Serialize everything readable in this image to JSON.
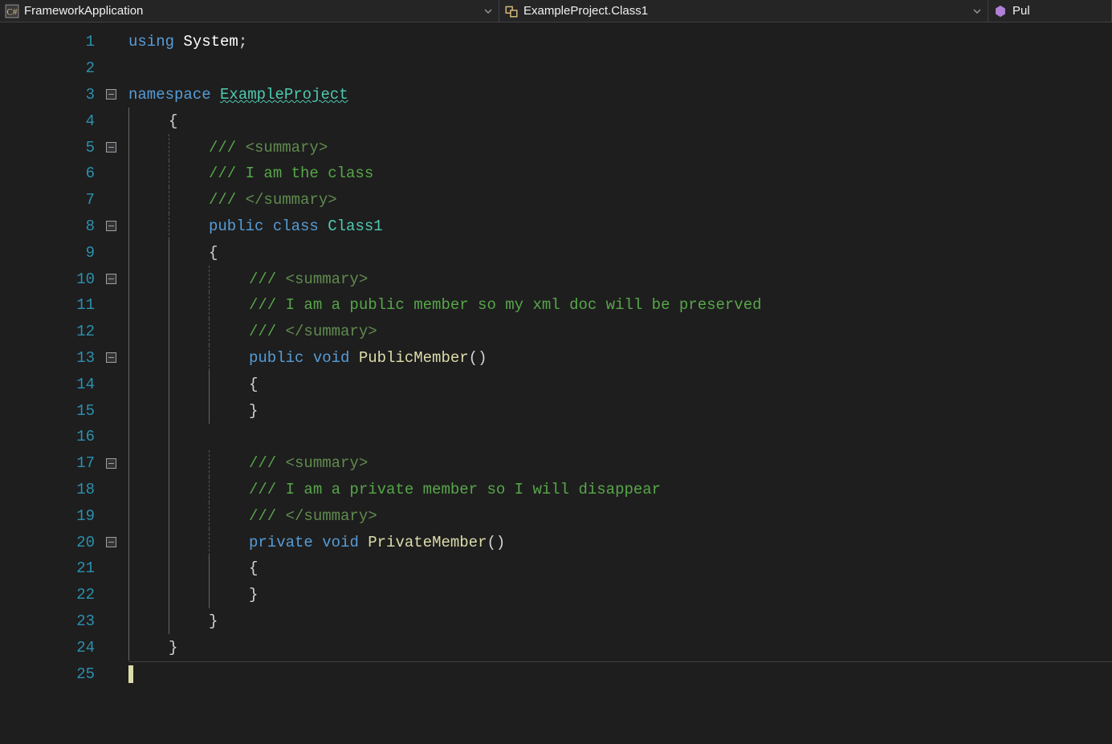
{
  "nav": {
    "project": {
      "label": "FrameworkApplication",
      "icon": "csharp-file-icon"
    },
    "class": {
      "label": "ExampleProject.Class1",
      "icon": "class-icon"
    },
    "member": {
      "label": "Pul",
      "icon": "method-icon"
    }
  },
  "code": {
    "lines": [
      {
        "n": 1,
        "fold": null,
        "guides": [
          "none"
        ],
        "tokens": [
          {
            "t": "keyword",
            "s": "using"
          },
          {
            "t": "punct",
            "s": " "
          },
          {
            "t": "white",
            "s": "System"
          },
          {
            "t": "punct",
            "s": ";"
          }
        ]
      },
      {
        "n": 2,
        "fold": null,
        "guides": [
          "none"
        ],
        "tokens": []
      },
      {
        "n": 3,
        "fold": "minus",
        "guides": [
          "none"
        ],
        "tokens": [
          {
            "t": "keyword",
            "s": "namespace"
          },
          {
            "t": "punct",
            "s": " "
          },
          {
            "t": "type-u",
            "s": "ExampleProject"
          }
        ]
      },
      {
        "n": 4,
        "fold": null,
        "guides": [
          "solid"
        ],
        "tokens": [
          {
            "t": "punct",
            "s": "{"
          }
        ]
      },
      {
        "n": 5,
        "fold": "minus",
        "guides": [
          "solid",
          "dashed"
        ],
        "tokens": [
          {
            "t": "comment",
            "s": "/// "
          },
          {
            "t": "xmltag",
            "s": "<summary>"
          }
        ]
      },
      {
        "n": 6,
        "fold": null,
        "guides": [
          "solid",
          "dashed"
        ],
        "tokens": [
          {
            "t": "comment",
            "s": "/// I am the class"
          }
        ]
      },
      {
        "n": 7,
        "fold": null,
        "guides": [
          "solid",
          "dashed"
        ],
        "tokens": [
          {
            "t": "comment",
            "s": "/// "
          },
          {
            "t": "xmltag",
            "s": "</summary>"
          }
        ]
      },
      {
        "n": 8,
        "fold": "minus",
        "guides": [
          "solid",
          "dashed"
        ],
        "tokens": [
          {
            "t": "keyword",
            "s": "public"
          },
          {
            "t": "punct",
            "s": " "
          },
          {
            "t": "keyword",
            "s": "class"
          },
          {
            "t": "punct",
            "s": " "
          },
          {
            "t": "type",
            "s": "Class1"
          }
        ]
      },
      {
        "n": 9,
        "fold": null,
        "guides": [
          "solid",
          "solid"
        ],
        "tokens": [
          {
            "t": "punct",
            "s": "{"
          }
        ]
      },
      {
        "n": 10,
        "fold": "minus",
        "guides": [
          "solid",
          "solid",
          "dashed"
        ],
        "tokens": [
          {
            "t": "comment",
            "s": "/// "
          },
          {
            "t": "xmltag",
            "s": "<summary>"
          }
        ]
      },
      {
        "n": 11,
        "fold": null,
        "guides": [
          "solid",
          "solid",
          "dashed"
        ],
        "tokens": [
          {
            "t": "comment",
            "s": "/// I am a public member so my xml doc will be preserved"
          }
        ]
      },
      {
        "n": 12,
        "fold": null,
        "guides": [
          "solid",
          "solid",
          "dashed"
        ],
        "tokens": [
          {
            "t": "comment",
            "s": "/// "
          },
          {
            "t": "xmltag",
            "s": "</summary>"
          }
        ]
      },
      {
        "n": 13,
        "fold": "minus",
        "guides": [
          "solid",
          "solid",
          "dashed"
        ],
        "tokens": [
          {
            "t": "keyword",
            "s": "public"
          },
          {
            "t": "punct",
            "s": " "
          },
          {
            "t": "keyword",
            "s": "void"
          },
          {
            "t": "punct",
            "s": " "
          },
          {
            "t": "method",
            "s": "PublicMember"
          },
          {
            "t": "punct",
            "s": "()"
          }
        ]
      },
      {
        "n": 14,
        "fold": null,
        "guides": [
          "solid",
          "solid",
          "solid"
        ],
        "tokens": [
          {
            "t": "punct",
            "s": "{"
          }
        ]
      },
      {
        "n": 15,
        "fold": null,
        "guides": [
          "solid",
          "solid",
          "solid"
        ],
        "tokens": [
          {
            "t": "punct",
            "s": "}"
          }
        ]
      },
      {
        "n": 16,
        "fold": null,
        "guides": [
          "solid",
          "solid"
        ],
        "tokens": []
      },
      {
        "n": 17,
        "fold": "minus",
        "guides": [
          "solid",
          "solid",
          "dashed"
        ],
        "tokens": [
          {
            "t": "comment",
            "s": "/// "
          },
          {
            "t": "xmltag",
            "s": "<summary>"
          }
        ]
      },
      {
        "n": 18,
        "fold": null,
        "guides": [
          "solid",
          "solid",
          "dashed"
        ],
        "tokens": [
          {
            "t": "comment",
            "s": "/// I am a private member so I will disappear"
          }
        ]
      },
      {
        "n": 19,
        "fold": null,
        "guides": [
          "solid",
          "solid",
          "dashed"
        ],
        "tokens": [
          {
            "t": "comment",
            "s": "/// "
          },
          {
            "t": "xmltag",
            "s": "</summary>"
          }
        ]
      },
      {
        "n": 20,
        "fold": "minus",
        "guides": [
          "solid",
          "solid",
          "dashed"
        ],
        "tokens": [
          {
            "t": "keyword",
            "s": "private"
          },
          {
            "t": "punct",
            "s": " "
          },
          {
            "t": "keyword",
            "s": "void"
          },
          {
            "t": "punct",
            "s": " "
          },
          {
            "t": "method",
            "s": "PrivateMember"
          },
          {
            "t": "punct",
            "s": "()"
          }
        ]
      },
      {
        "n": 21,
        "fold": null,
        "guides": [
          "solid",
          "solid",
          "solid"
        ],
        "tokens": [
          {
            "t": "punct",
            "s": "{"
          }
        ]
      },
      {
        "n": 22,
        "fold": null,
        "guides": [
          "solid",
          "solid",
          "solid"
        ],
        "tokens": [
          {
            "t": "punct",
            "s": "}"
          }
        ]
      },
      {
        "n": 23,
        "fold": null,
        "guides": [
          "solid",
          "solid"
        ],
        "tokens": [
          {
            "t": "punct",
            "s": "}"
          }
        ]
      },
      {
        "n": 24,
        "fold": null,
        "guides": [
          "solid"
        ],
        "tokens": [
          {
            "t": "punct",
            "s": "}"
          }
        ]
      },
      {
        "n": 25,
        "fold": null,
        "guides": [
          "none"
        ],
        "tokens": [],
        "cursor": true
      }
    ]
  }
}
